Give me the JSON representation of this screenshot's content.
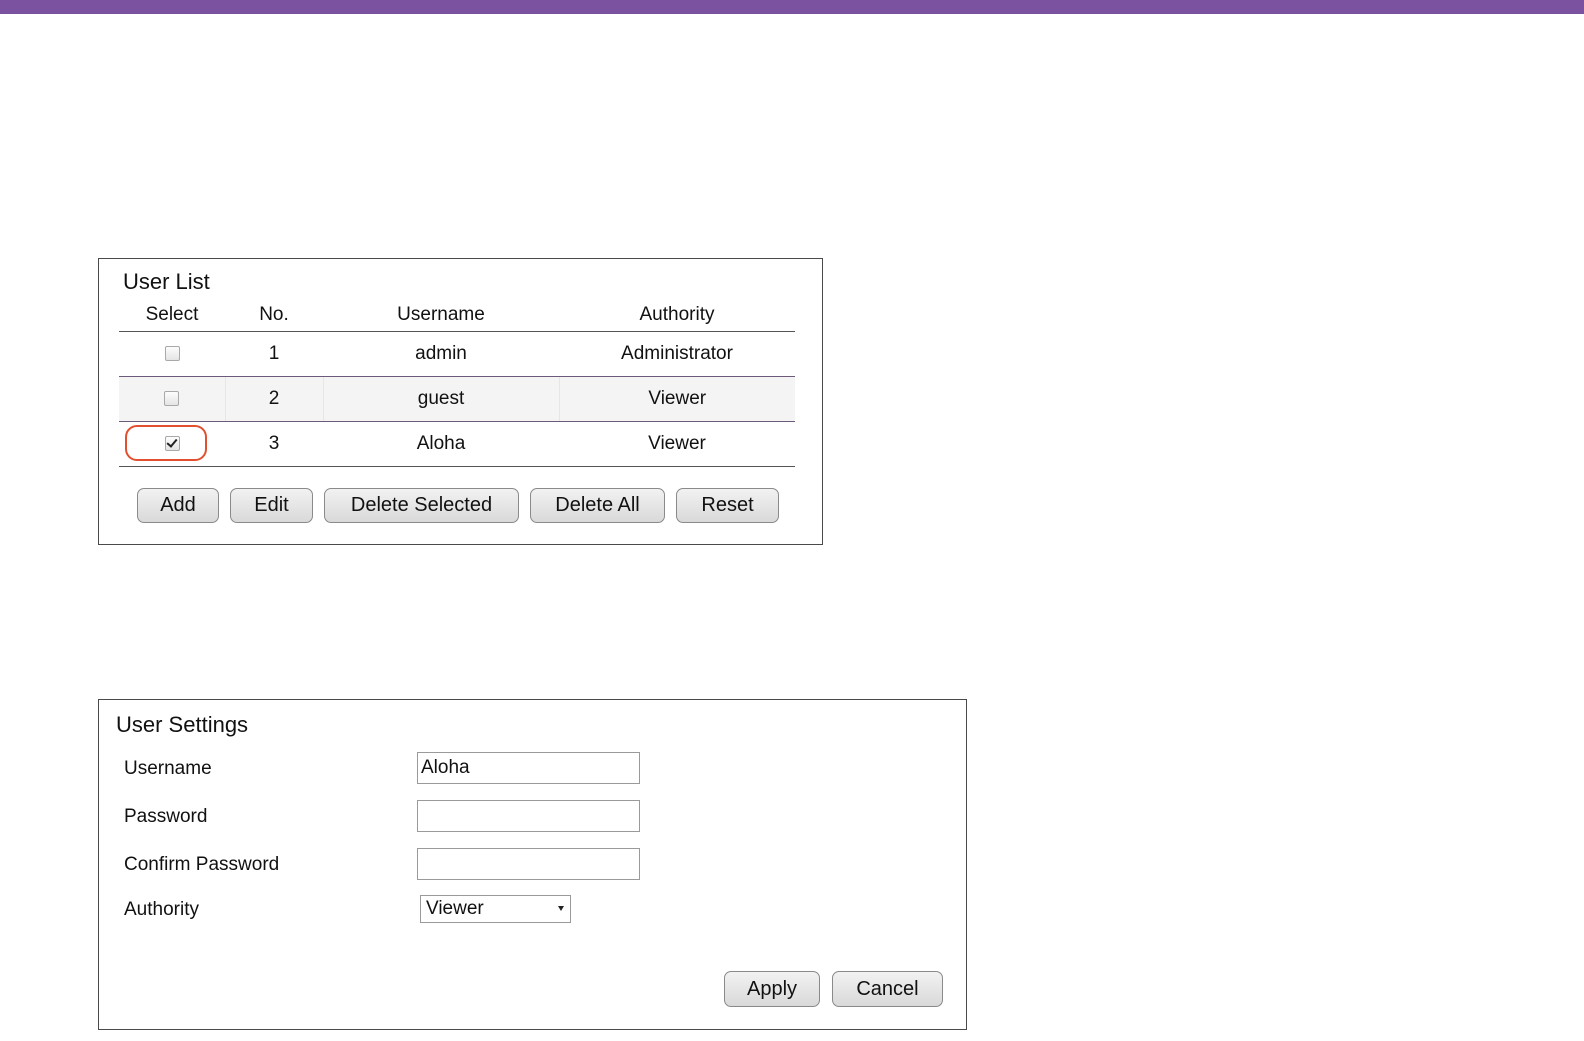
{
  "user_list": {
    "title": "User List",
    "columns": [
      "Select",
      "No.",
      "Username",
      "Authority"
    ],
    "rows": [
      {
        "selected": false,
        "no": "1",
        "username": "admin",
        "authority": "Administrator"
      },
      {
        "selected": false,
        "no": "2",
        "username": "guest",
        "authority": "Viewer"
      },
      {
        "selected": true,
        "no": "3",
        "username": "Aloha",
        "authority": "Viewer"
      }
    ],
    "buttons": {
      "add": "Add",
      "edit": "Edit",
      "delete_selected": "Delete Selected",
      "delete_all": "Delete All",
      "reset": "Reset"
    }
  },
  "user_settings": {
    "title": "User Settings",
    "username_label": "Username",
    "username_value": "Aloha",
    "password_label": "Password",
    "password_value": "",
    "confirm_password_label": "Confirm Password",
    "confirm_password_value": "",
    "authority_label": "Authority",
    "authority_value": "Viewer",
    "buttons": {
      "apply": "Apply",
      "cancel": "Cancel"
    }
  },
  "colors": {
    "top_bar": "#7b52a0",
    "highlight_ring": "#e2502f"
  }
}
